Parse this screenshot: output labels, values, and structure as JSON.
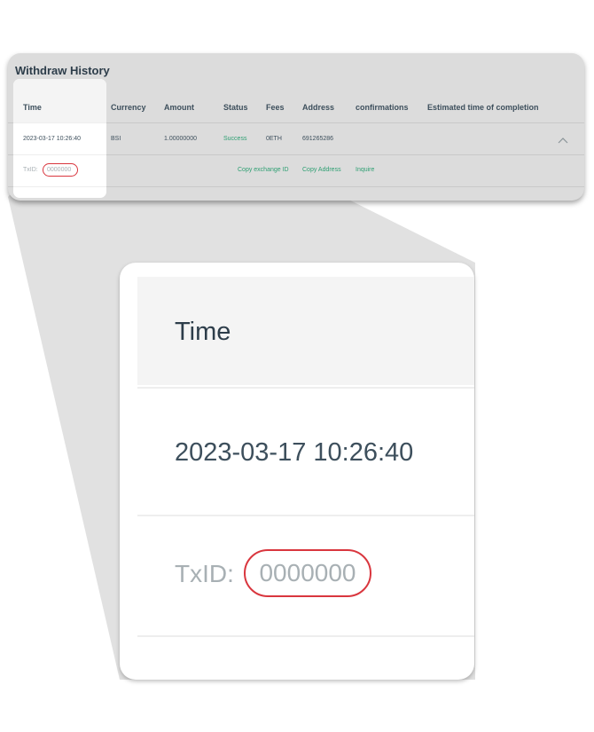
{
  "withdraw_history": {
    "title": "Withdraw History",
    "columns": [
      "Time",
      "Currency",
      "Amount",
      "Status",
      "Fees",
      "Address",
      "confirmations",
      "Estimated time of completion"
    ],
    "row": {
      "time": "2023-03-17 10:26:40",
      "currency": "BSI",
      "amount": "1.00000000",
      "status": "Success",
      "fees": "0ETH",
      "address": "691265286",
      "confirmations": "",
      "estimated_time": ""
    },
    "detail": {
      "txid_label": "TxID:",
      "txid_value": "0000000",
      "copy_exchange_id": "Copy exchange ID",
      "copy_address": "Copy Address",
      "inquire": "Inquire"
    },
    "expand_icon": "chevron-up-icon"
  },
  "zoom_panel": {
    "time_header": "Time",
    "date": "2023-03-17 10:26:40",
    "txid_label": "TxID:",
    "txid_value": "0000000"
  },
  "colors": {
    "success": "#2e9f72",
    "highlight_ring": "#d9363e",
    "text_dark": "#2d3d4a",
    "text_muted": "#a8b0b4",
    "card_bg": "#dcdcdc"
  }
}
